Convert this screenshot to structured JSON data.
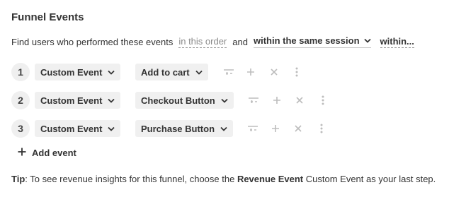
{
  "title": "Funnel Events",
  "query": {
    "prefix": "Find users who performed these events",
    "order_label": "in this order",
    "and": "and",
    "session_label": "within the same session",
    "within_label": "within..."
  },
  "steps": [
    {
      "number": "1",
      "event_type": "Custom Event",
      "event_name": "Add to cart"
    },
    {
      "number": "2",
      "event_type": "Custom Event",
      "event_name": "Checkout Button"
    },
    {
      "number": "3",
      "event_type": "Custom Event",
      "event_name": "Purchase Button"
    }
  ],
  "add_event_label": "Add event",
  "tip": {
    "lead": "Tip",
    "text1": ": To see revenue insights for this funnel, choose the ",
    "highlight": "Revenue Event",
    "text2": " Custom Event as your last step."
  },
  "colors": {
    "icon_muted": "#bdbdbd",
    "chip_bg": "#f0f0f0",
    "text": "#333333"
  },
  "icons": [
    "chevron-down-icon",
    "filter-icon",
    "plus-icon",
    "close-icon",
    "more-vertical-icon"
  ]
}
